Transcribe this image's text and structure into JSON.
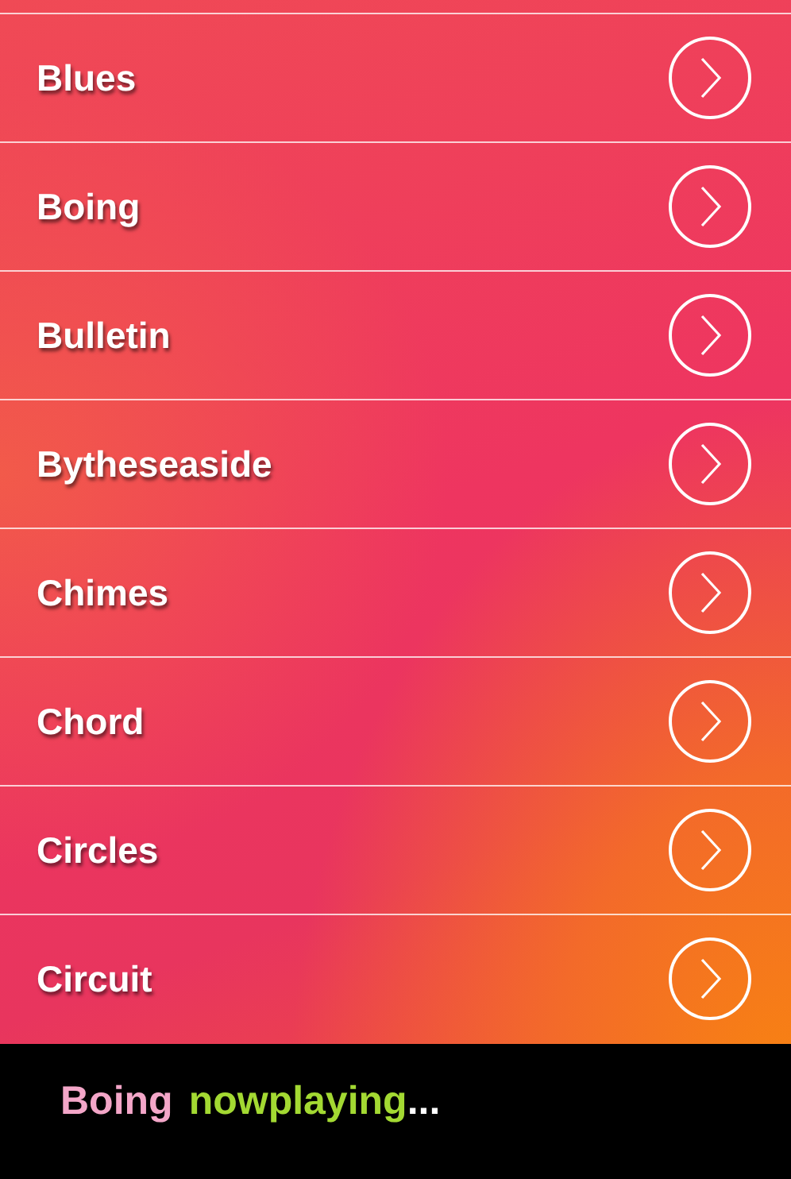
{
  "sounds": [
    {
      "name": "Blues"
    },
    {
      "name": "Boing"
    },
    {
      "name": "Bulletin"
    },
    {
      "name": "Bytheseaside"
    },
    {
      "name": "Chimes"
    },
    {
      "name": "Chord"
    },
    {
      "name": "Circles"
    },
    {
      "name": "Circuit"
    }
  ],
  "now_playing": {
    "title": "Boing",
    "status": "nowplaying",
    "ellipsis": "..."
  }
}
